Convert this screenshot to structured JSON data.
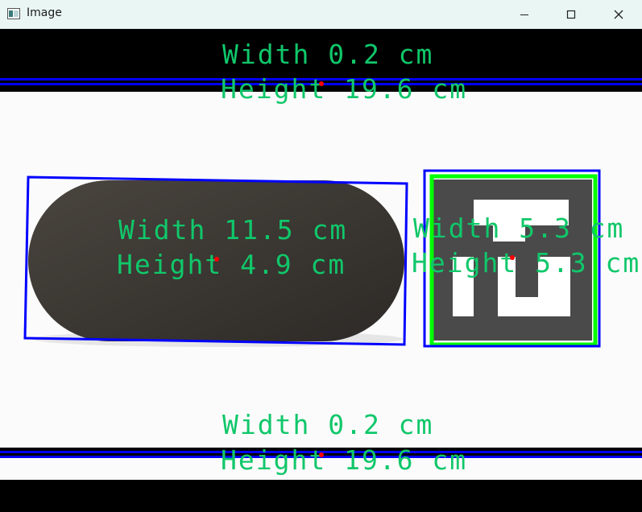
{
  "window": {
    "title": "Image",
    "controls": {
      "minimize": "minimize-icon",
      "maximize": "maximize-icon",
      "close": "close-icon"
    }
  },
  "measurements": {
    "top_strip": {
      "width_text": "Width 0.2 cm",
      "height_text": "Height 19.6 cm"
    },
    "object_left": {
      "width_text": "Width 11.5 cm",
      "height_text": "Height 4.9 cm"
    },
    "object_right": {
      "width_text": "Width 5.3 cm",
      "height_text": "Height 5.3 cm"
    },
    "bottom_strip": {
      "width_text": "Width 0.2 cm",
      "height_text": "Height 19.6 cm"
    }
  },
  "colors": {
    "label_green": "#10c76a",
    "box_blue": "#0000ff",
    "marker_green": "#00ff00",
    "center_red": "#ff0000",
    "titlebar_bg": "#e9f6f4"
  }
}
